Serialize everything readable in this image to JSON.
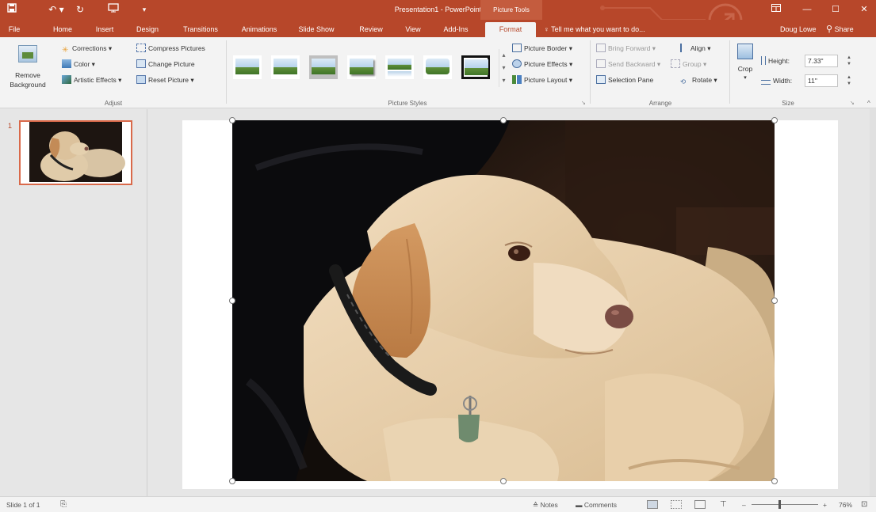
{
  "title_bar": {
    "title": "Presentation1 - PowerPoint",
    "contextual_group": "Picture Tools",
    "colors": {
      "accent": "#b7472a",
      "ribbon_bg": "#f3f3f3"
    }
  },
  "tabs": [
    {
      "label": "File"
    },
    {
      "label": "Home"
    },
    {
      "label": "Insert"
    },
    {
      "label": "Design"
    },
    {
      "label": "Transitions"
    },
    {
      "label": "Animations"
    },
    {
      "label": "Slide Show"
    },
    {
      "label": "Review"
    },
    {
      "label": "View"
    },
    {
      "label": "Add-Ins"
    },
    {
      "label": "Format"
    }
  ],
  "tell_me": "Tell me what you want to do...",
  "user_name": "Doug Lowe",
  "share_label": "Share",
  "ribbon": {
    "adjust": {
      "remove_background_1": "Remove",
      "remove_background_2": "Background",
      "corrections": "Corrections",
      "color": "Color",
      "artistic_effects": "Artistic Effects",
      "compress_pictures": "Compress Pictures",
      "change_picture": "Change Picture",
      "reset_picture": "Reset Picture",
      "group_label": "Adjust"
    },
    "picture_styles": {
      "picture_border": "Picture Border",
      "picture_effects": "Picture Effects",
      "picture_layout": "Picture Layout",
      "group_label": "Picture Styles"
    },
    "arrange": {
      "bring_forward": "Bring Forward",
      "send_backward": "Send Backward",
      "selection_pane": "Selection Pane",
      "align": "Align",
      "group": "Group",
      "rotate": "Rotate",
      "group_label": "Arrange"
    },
    "size": {
      "crop": "Crop",
      "height_label": "Height:",
      "height_value": "7.33\"",
      "width_label": "Width:",
      "width_value": "11\"",
      "group_label": "Size"
    }
  },
  "thumbnails": {
    "slide_number": "1"
  },
  "status_bar": {
    "slide_info": "Slide 1 of 1",
    "notes": "Notes",
    "comments": "Comments",
    "zoom": "76%"
  }
}
